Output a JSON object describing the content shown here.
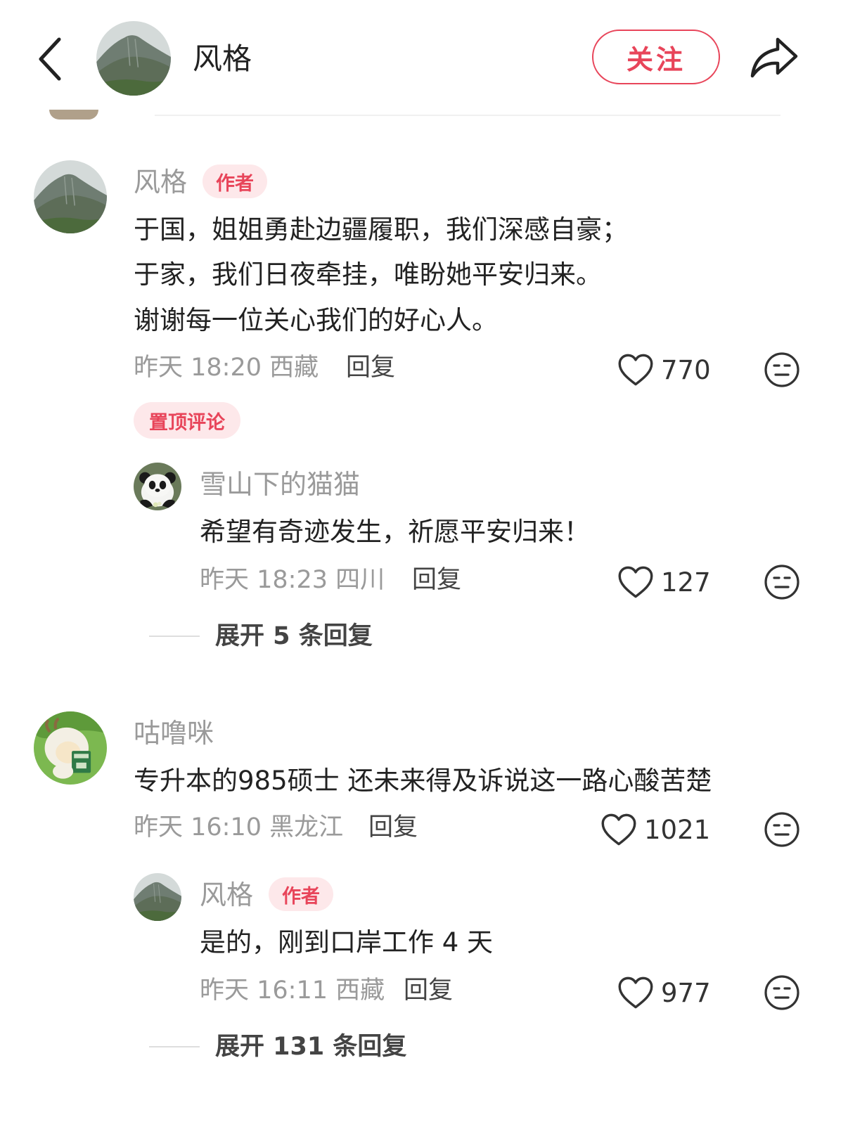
{
  "header": {
    "title": "风格",
    "follow_label": "关注"
  },
  "comments": [
    {
      "username": "风格",
      "badge": "作者",
      "lines": [
        "于国，姐姐勇赴边疆履职，我们深感自豪；",
        "于家，我们日夜牵挂，唯盼她平安归来。",
        "谢谢每一位关心我们的好心人。"
      ],
      "time": "昨天 18:20",
      "location": "西藏",
      "reply_label": "回复",
      "likes": "770",
      "pinned_label": "置顶评论",
      "replies": [
        {
          "username": "雪山下的猫猫",
          "text": "希望有奇迹发生，祈愿平安归来！",
          "time": "昨天 18:23",
          "location": "四川",
          "reply_label": "回复",
          "likes": "127"
        }
      ],
      "expand_label": "展开 5 条回复"
    },
    {
      "username": "咕噜咪",
      "text": "专升本的985硕士 还未来得及诉说这一路心酸苦楚",
      "time": "昨天 16:10",
      "location": "黑龙江",
      "reply_label": "回复",
      "likes": "1021",
      "replies": [
        {
          "username": "风格",
          "badge": "作者",
          "text": "是的，刚到口岸工作 4 天",
          "time": "昨天 16:11",
          "location": "西藏",
          "reply_label": "回复",
          "likes": "977"
        }
      ],
      "expand_label": "展开 131 条回复"
    }
  ],
  "colors": {
    "accent": "#e8455a",
    "badge_bg": "#fde8ea",
    "muted": "#9a9a9a"
  }
}
